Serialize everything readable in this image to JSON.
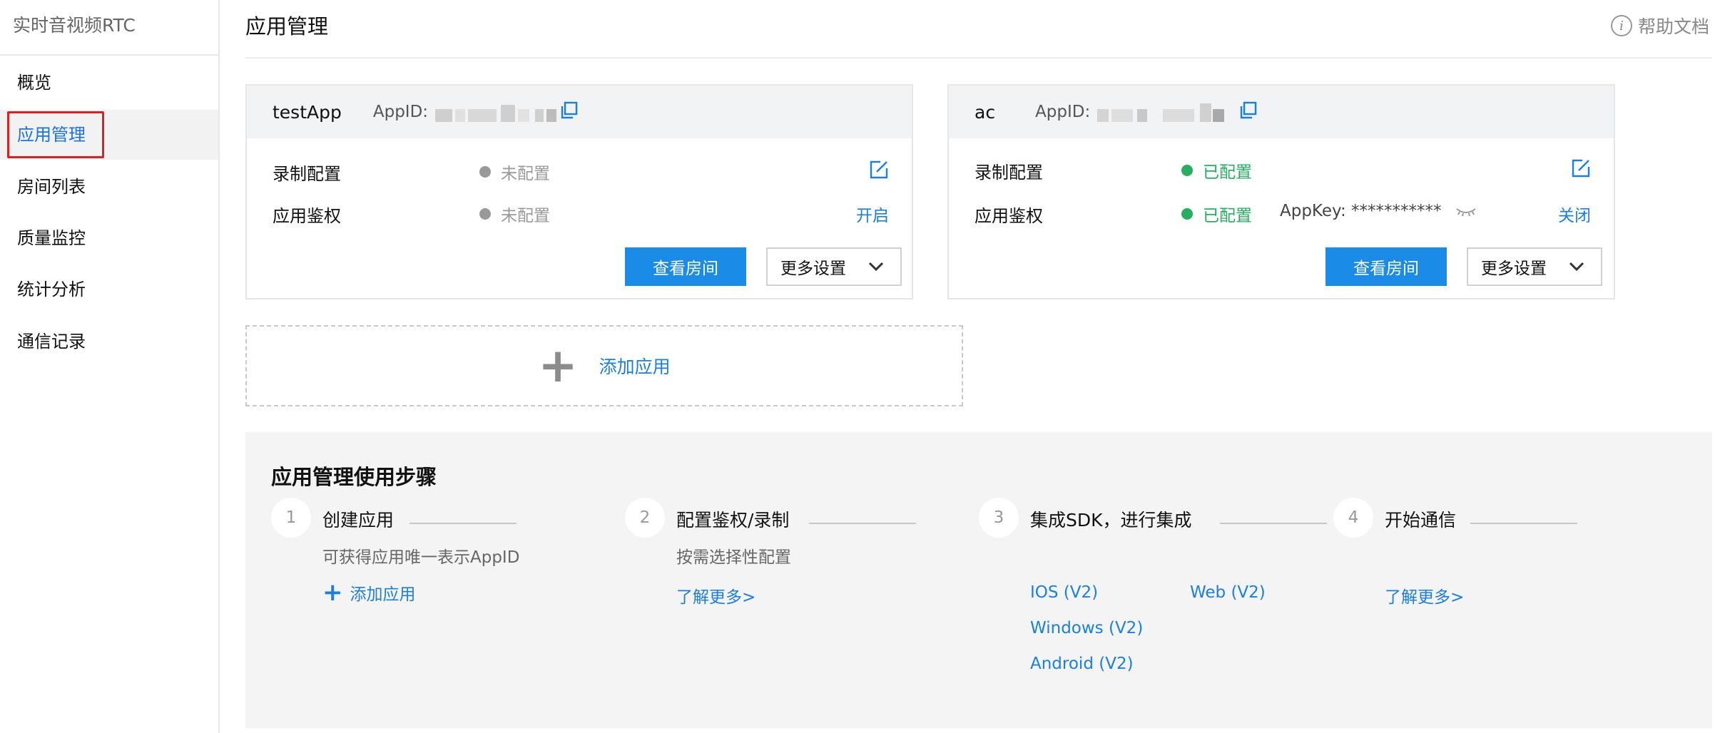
{
  "sidebar": {
    "title": "实时音视频RTC",
    "items": [
      {
        "label": "概览"
      },
      {
        "label": "应用管理"
      },
      {
        "label": "房间列表"
      },
      {
        "label": "质量监控"
      },
      {
        "label": "统计分析"
      },
      {
        "label": "通信记录"
      }
    ],
    "active_index": 1
  },
  "header": {
    "title": "应用管理",
    "help_label": "帮助文档",
    "help_icon": "info-circle-icon"
  },
  "apps": [
    {
      "name": "testApp",
      "appid_label": "AppID:",
      "record_label": "录制配置",
      "record_status": "未配置",
      "auth_label": "应用鉴权",
      "auth_status": "未配置",
      "auth_action": "开启",
      "view_rooms": "查看房间",
      "more_settings": "更多设置"
    },
    {
      "name": "ac",
      "appid_label": "AppID:",
      "record_label": "录制配置",
      "record_status": "已配置",
      "auth_label": "应用鉴权",
      "auth_status": "已配置",
      "appkey_label": "AppKey: ***********",
      "auth_action": "关闭",
      "view_rooms": "查看房间",
      "more_settings": "更多设置"
    }
  ],
  "add_app": {
    "label": "添加应用"
  },
  "steps": {
    "title": "应用管理使用步骤",
    "items": [
      {
        "num": "1",
        "title": "创建应用",
        "desc": "可获得应用唯一表示AppID",
        "link": "添加应用"
      },
      {
        "num": "2",
        "title": "配置鉴权/录制",
        "desc": "按需选择性配置",
        "link": "了解更多>"
      },
      {
        "num": "3",
        "title": "集成SDK，进行集成",
        "links": [
          "IOS (V2)",
          "Web (V2)",
          "Windows (V2)",
          "Android (V2)"
        ]
      },
      {
        "num": "4",
        "title": "开始通信",
        "link": "了解更多>"
      }
    ]
  },
  "colors": {
    "accent": "#1a7fe0",
    "primary_button": "#1a8be6",
    "configured_green": "#27ae60",
    "unconfigured_gray": "#999999",
    "highlight_red": "#e02020"
  }
}
